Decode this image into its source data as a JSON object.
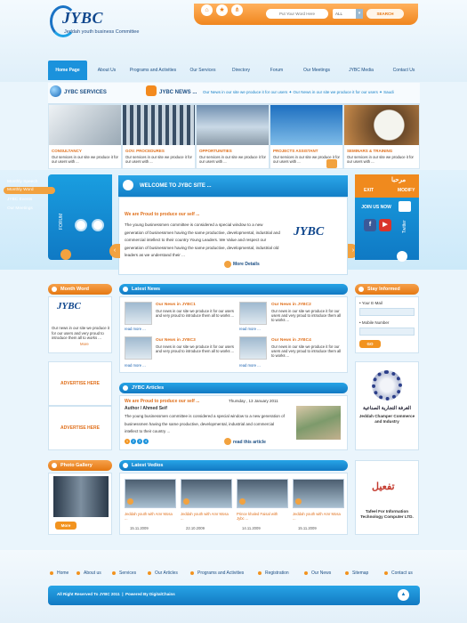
{
  "header": {
    "logo_text": "JYBC",
    "logo_sub": "Jeddah youth business Committee",
    "search_placeholder": "Put Your Word Here",
    "search_scope": "ALL",
    "search_button": "SEARCH"
  },
  "nav": [
    "Home Page",
    "About Us",
    "Programs and Activities",
    "Our Services",
    "Directory",
    "Forum",
    "Our Meetings",
    "JYBC Media",
    "Contact Us"
  ],
  "newsbar": {
    "services_title": "JYBC SERVICES",
    "news_title": "JYBC NEWS ...",
    "ticker": "Our News in our site we produce it for our users ✦ Our News in our site we produce it for our users ✦ Saudi"
  },
  "services": [
    {
      "title": "CONSULTANCY",
      "desc": "Our services in our site we produce it for our users with ..."
    },
    {
      "title": "GOV. PROCEDURES",
      "desc": "Our services in our site we produce it for our users with ..."
    },
    {
      "title": "OPPORTUNITIES",
      "desc": "Our services in our site we produce it for our users with ..."
    },
    {
      "title": "PROJECTS ASSISTANT",
      "desc": "Our services in our site we produce it for our users with ..."
    },
    {
      "title": "SEMINARS & TRAINING",
      "desc": "Our services in our site we produce it for our users with ..."
    }
  ],
  "leftmenu": {
    "items": [
      "Monthly Speech",
      "Monthly Word",
      "JYBC Events",
      "Our Meetings"
    ],
    "forum": "FORUM"
  },
  "welcome": {
    "bar": "WELCOME TO JYBC SITE ...",
    "headline": "We are Proud to produce our self ...",
    "text": "The young businessmen committee is considered a special window to a new generation of businessmen having the same productive, developmental, industrial and commercial intellect to their country Young Leaders. We Value and respect our generation of businessmen having the same productive, developmental, industrial old leaders as we understand their ...",
    "logo": "JYBC",
    "more": "More Details"
  },
  "rightmenu": {
    "arabic": "مرحبا",
    "exit": "EXIT",
    "modify": "MODIFY",
    "join": "JOIN US NOW",
    "twitter": "Twitter"
  },
  "month_word": {
    "title": "Month Word",
    "logo": "JYBC",
    "text": "Our news in our site we produce it for our users and very proud to introduce them all to works ...",
    "more": "More"
  },
  "advertise": [
    "ADVERTISE HERE",
    "ADVERTISE HERE"
  ],
  "photo_gallery": {
    "title": "Photo Gallery",
    "more": "More"
  },
  "latest_news": {
    "title": "Latest News",
    "items": [
      {
        "title": "Our News in JYBC1",
        "desc": "Our news in our site we produce it for our users and very proud to introduce them all to works ...",
        "more": "read more ..."
      },
      {
        "title": "Our News in JYBC2",
        "desc": "Our news in our site we produce it for our users and very proud to introduce them all to works ...",
        "more": "read more ..."
      },
      {
        "title": "Our News in JYBC3",
        "desc": "Our news in our site we produce it for our users and very proud to introduce them all to works ...",
        "more": "read more ..."
      },
      {
        "title": "Our News in JYBC4",
        "desc": "Our news in our site we produce it for our users and very proud to introduce them all to works ...",
        "more": "read more ..."
      }
    ]
  },
  "articles": {
    "title": "JYBC Articles",
    "headline": "We are Proud to produce our self ...",
    "date": "Thursday , 13 January 2011",
    "author": "Author / Ahmed Seif",
    "text": "The young businessmen committee is considered a special window to a new generation of businessmen having the same productive, developmental, industrial and commercial intellect to their country ...",
    "pages": [
      "1",
      "2",
      "3",
      "4"
    ],
    "read": "read this article"
  },
  "videos": {
    "title": "Latest Vedios",
    "items": [
      {
        "title": "Jeddah youth with Amr Mosa ...",
        "date": "15.11.2009"
      },
      {
        "title": "Jeddah youth with Amr Mosa ...",
        "date": "22.10.2009"
      },
      {
        "title": "Prince khaled Faisal with Jybc ...",
        "date": "14.11.2009"
      },
      {
        "title": "Jeddah youth with Amr Mosa ...",
        "date": "15.11.2009"
      }
    ]
  },
  "stay_informed": {
    "title": "Stay Informed",
    "email_label": "Your E-Mail",
    "mobile_label": "Mobile Number",
    "go": "GO"
  },
  "sponsors": [
    {
      "arabic": "الغرفة التجارية الصناعية",
      "name": "Jeddah Champer Commerce and Industry"
    },
    {
      "arabic": "تفعيل",
      "name": "Tafeel For Information Technology Computer LTD."
    }
  ],
  "footer": {
    "links": [
      "Home",
      "About us",
      "Services",
      "Our Articles",
      "Programs and Activities",
      "Registration",
      "Our News",
      "Sitemap",
      "Contact us"
    ],
    "copyright": "All Right Reserved To JYBC 2011",
    "powered": "Powered By DigitalChains"
  }
}
